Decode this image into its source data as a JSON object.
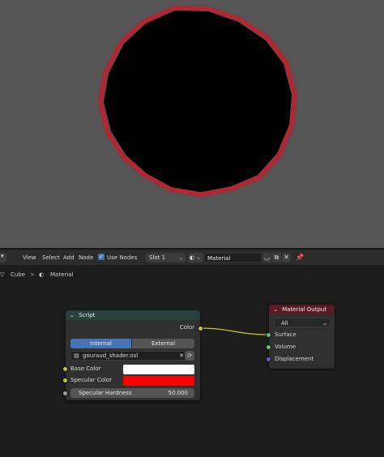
{
  "viewport": {
    "rim_color": "#e01020",
    "object_color": "#000000",
    "background": "#555555"
  },
  "header": {
    "editor_type_icon": "node-editor-icon",
    "menu": [
      "View",
      "Select",
      "Add",
      "Node"
    ],
    "use_nodes_label": "Use Nodes",
    "use_nodes_checked": true,
    "slot_label": "Slot 1",
    "material_name": "Material",
    "pin_icon": "pin-icon"
  },
  "breadcrumb": {
    "object": "Cube",
    "separator": ">",
    "material": "Material"
  },
  "nodes": {
    "script": {
      "title": "Script",
      "output_label": "Color",
      "mode_internal": "Internal",
      "mode_external": "External",
      "mode_selected": "Internal",
      "file_name": "gouraud_shader.osl",
      "inputs": {
        "base_color_label": "Base Color",
        "base_color_value": "#ffffff",
        "specular_color_label": "Specular Color",
        "specular_color_value": "#ff0000",
        "specular_hardness_label": "Specular Hardness",
        "specular_hardness_value": "50.000"
      }
    },
    "output": {
      "title": "Material Output",
      "target": "All",
      "sockets": [
        "Surface",
        "Volume",
        "Displacement"
      ]
    }
  },
  "colors": {
    "socket_color": "#c7c729",
    "socket_shader": "#63c763",
    "socket_vector": "#6363c7",
    "socket_float": "#a1a1a1",
    "accent": "#4772b3"
  }
}
